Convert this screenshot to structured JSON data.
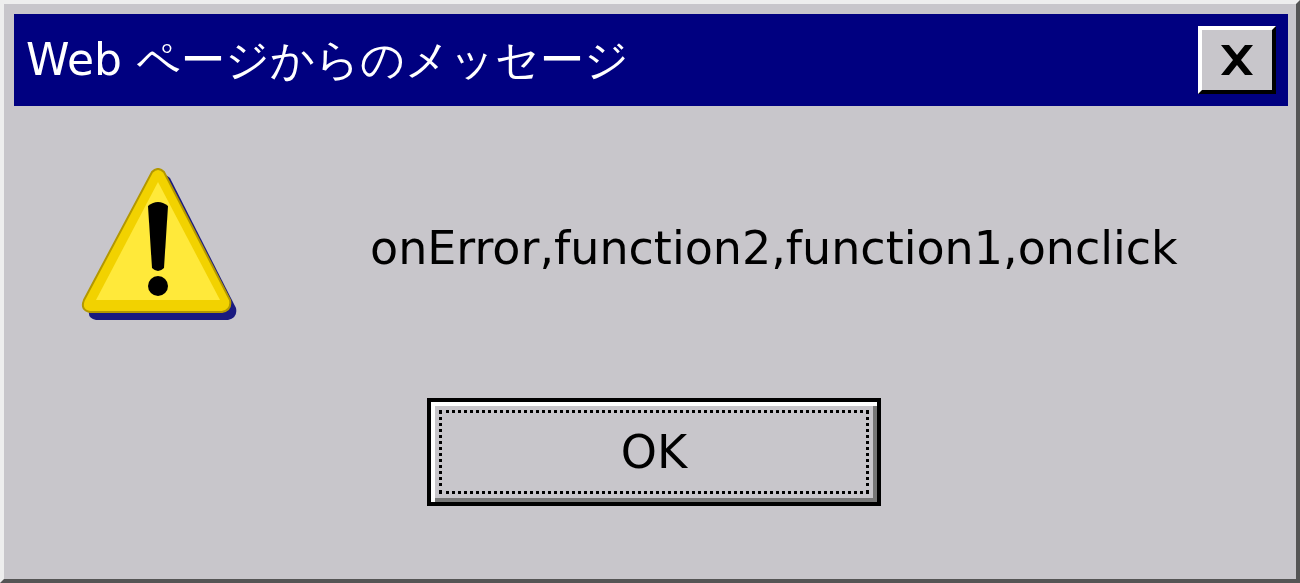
{
  "window": {
    "title": "Web ページからのメッセージ"
  },
  "message": "onError,function2,function1,onclick",
  "buttons": [
    {
      "label": "OK",
      "focused": true
    }
  ]
}
